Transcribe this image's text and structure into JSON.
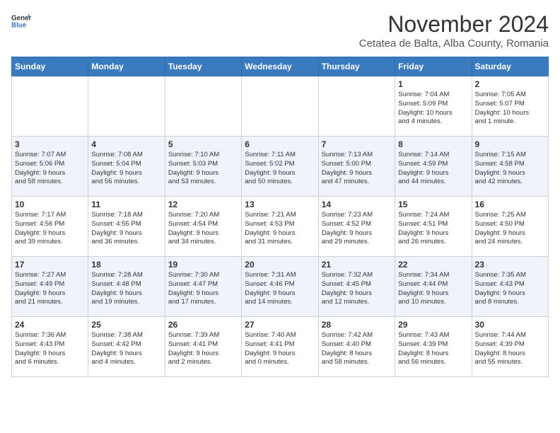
{
  "logo": {
    "general": "General",
    "blue": "Blue"
  },
  "title": "November 2024",
  "subtitle": "Cetatea de Balta, Alba County, Romania",
  "days_header": [
    "Sunday",
    "Monday",
    "Tuesday",
    "Wednesday",
    "Thursday",
    "Friday",
    "Saturday"
  ],
  "weeks": [
    [
      {
        "day": "",
        "info": ""
      },
      {
        "day": "",
        "info": ""
      },
      {
        "day": "",
        "info": ""
      },
      {
        "day": "",
        "info": ""
      },
      {
        "day": "",
        "info": ""
      },
      {
        "day": "1",
        "info": "Sunrise: 7:04 AM\nSunset: 5:09 PM\nDaylight: 10 hours\nand 4 minutes."
      },
      {
        "day": "2",
        "info": "Sunrise: 7:05 AM\nSunset: 5:07 PM\nDaylight: 10 hours\nand 1 minute."
      }
    ],
    [
      {
        "day": "3",
        "info": "Sunrise: 7:07 AM\nSunset: 5:06 PM\nDaylight: 9 hours\nand 58 minutes."
      },
      {
        "day": "4",
        "info": "Sunrise: 7:08 AM\nSunset: 5:04 PM\nDaylight: 9 hours\nand 56 minutes."
      },
      {
        "day": "5",
        "info": "Sunrise: 7:10 AM\nSunset: 5:03 PM\nDaylight: 9 hours\nand 53 minutes."
      },
      {
        "day": "6",
        "info": "Sunrise: 7:11 AM\nSunset: 5:02 PM\nDaylight: 9 hours\nand 50 minutes."
      },
      {
        "day": "7",
        "info": "Sunrise: 7:13 AM\nSunset: 5:00 PM\nDaylight: 9 hours\nand 47 minutes."
      },
      {
        "day": "8",
        "info": "Sunrise: 7:14 AM\nSunset: 4:59 PM\nDaylight: 9 hours\nand 44 minutes."
      },
      {
        "day": "9",
        "info": "Sunrise: 7:15 AM\nSunset: 4:58 PM\nDaylight: 9 hours\nand 42 minutes."
      }
    ],
    [
      {
        "day": "10",
        "info": "Sunrise: 7:17 AM\nSunset: 4:56 PM\nDaylight: 9 hours\nand 39 minutes."
      },
      {
        "day": "11",
        "info": "Sunrise: 7:18 AM\nSunset: 4:55 PM\nDaylight: 9 hours\nand 36 minutes."
      },
      {
        "day": "12",
        "info": "Sunrise: 7:20 AM\nSunset: 4:54 PM\nDaylight: 9 hours\nand 34 minutes."
      },
      {
        "day": "13",
        "info": "Sunrise: 7:21 AM\nSunset: 4:53 PM\nDaylight: 9 hours\nand 31 minutes."
      },
      {
        "day": "14",
        "info": "Sunrise: 7:23 AM\nSunset: 4:52 PM\nDaylight: 9 hours\nand 29 minutes."
      },
      {
        "day": "15",
        "info": "Sunrise: 7:24 AM\nSunset: 4:51 PM\nDaylight: 9 hours\nand 26 minutes."
      },
      {
        "day": "16",
        "info": "Sunrise: 7:25 AM\nSunset: 4:50 PM\nDaylight: 9 hours\nand 24 minutes."
      }
    ],
    [
      {
        "day": "17",
        "info": "Sunrise: 7:27 AM\nSunset: 4:49 PM\nDaylight: 9 hours\nand 21 minutes."
      },
      {
        "day": "18",
        "info": "Sunrise: 7:28 AM\nSunset: 4:48 PM\nDaylight: 9 hours\nand 19 minutes."
      },
      {
        "day": "19",
        "info": "Sunrise: 7:30 AM\nSunset: 4:47 PM\nDaylight: 9 hours\nand 17 minutes."
      },
      {
        "day": "20",
        "info": "Sunrise: 7:31 AM\nSunset: 4:46 PM\nDaylight: 9 hours\nand 14 minutes."
      },
      {
        "day": "21",
        "info": "Sunrise: 7:32 AM\nSunset: 4:45 PM\nDaylight: 9 hours\nand 12 minutes."
      },
      {
        "day": "22",
        "info": "Sunrise: 7:34 AM\nSunset: 4:44 PM\nDaylight: 9 hours\nand 10 minutes."
      },
      {
        "day": "23",
        "info": "Sunrise: 7:35 AM\nSunset: 4:43 PM\nDaylight: 9 hours\nand 8 minutes."
      }
    ],
    [
      {
        "day": "24",
        "info": "Sunrise: 7:36 AM\nSunset: 4:43 PM\nDaylight: 9 hours\nand 6 minutes."
      },
      {
        "day": "25",
        "info": "Sunrise: 7:38 AM\nSunset: 4:42 PM\nDaylight: 9 hours\nand 4 minutes."
      },
      {
        "day": "26",
        "info": "Sunrise: 7:39 AM\nSunset: 4:41 PM\nDaylight: 9 hours\nand 2 minutes."
      },
      {
        "day": "27",
        "info": "Sunrise: 7:40 AM\nSunset: 4:41 PM\nDaylight: 9 hours\nand 0 minutes."
      },
      {
        "day": "28",
        "info": "Sunrise: 7:42 AM\nSunset: 4:40 PM\nDaylight: 8 hours\nand 58 minutes."
      },
      {
        "day": "29",
        "info": "Sunrise: 7:43 AM\nSunset: 4:39 PM\nDaylight: 8 hours\nand 56 minutes."
      },
      {
        "day": "30",
        "info": "Sunrise: 7:44 AM\nSunset: 4:39 PM\nDaylight: 8 hours\nand 55 minutes."
      }
    ]
  ]
}
